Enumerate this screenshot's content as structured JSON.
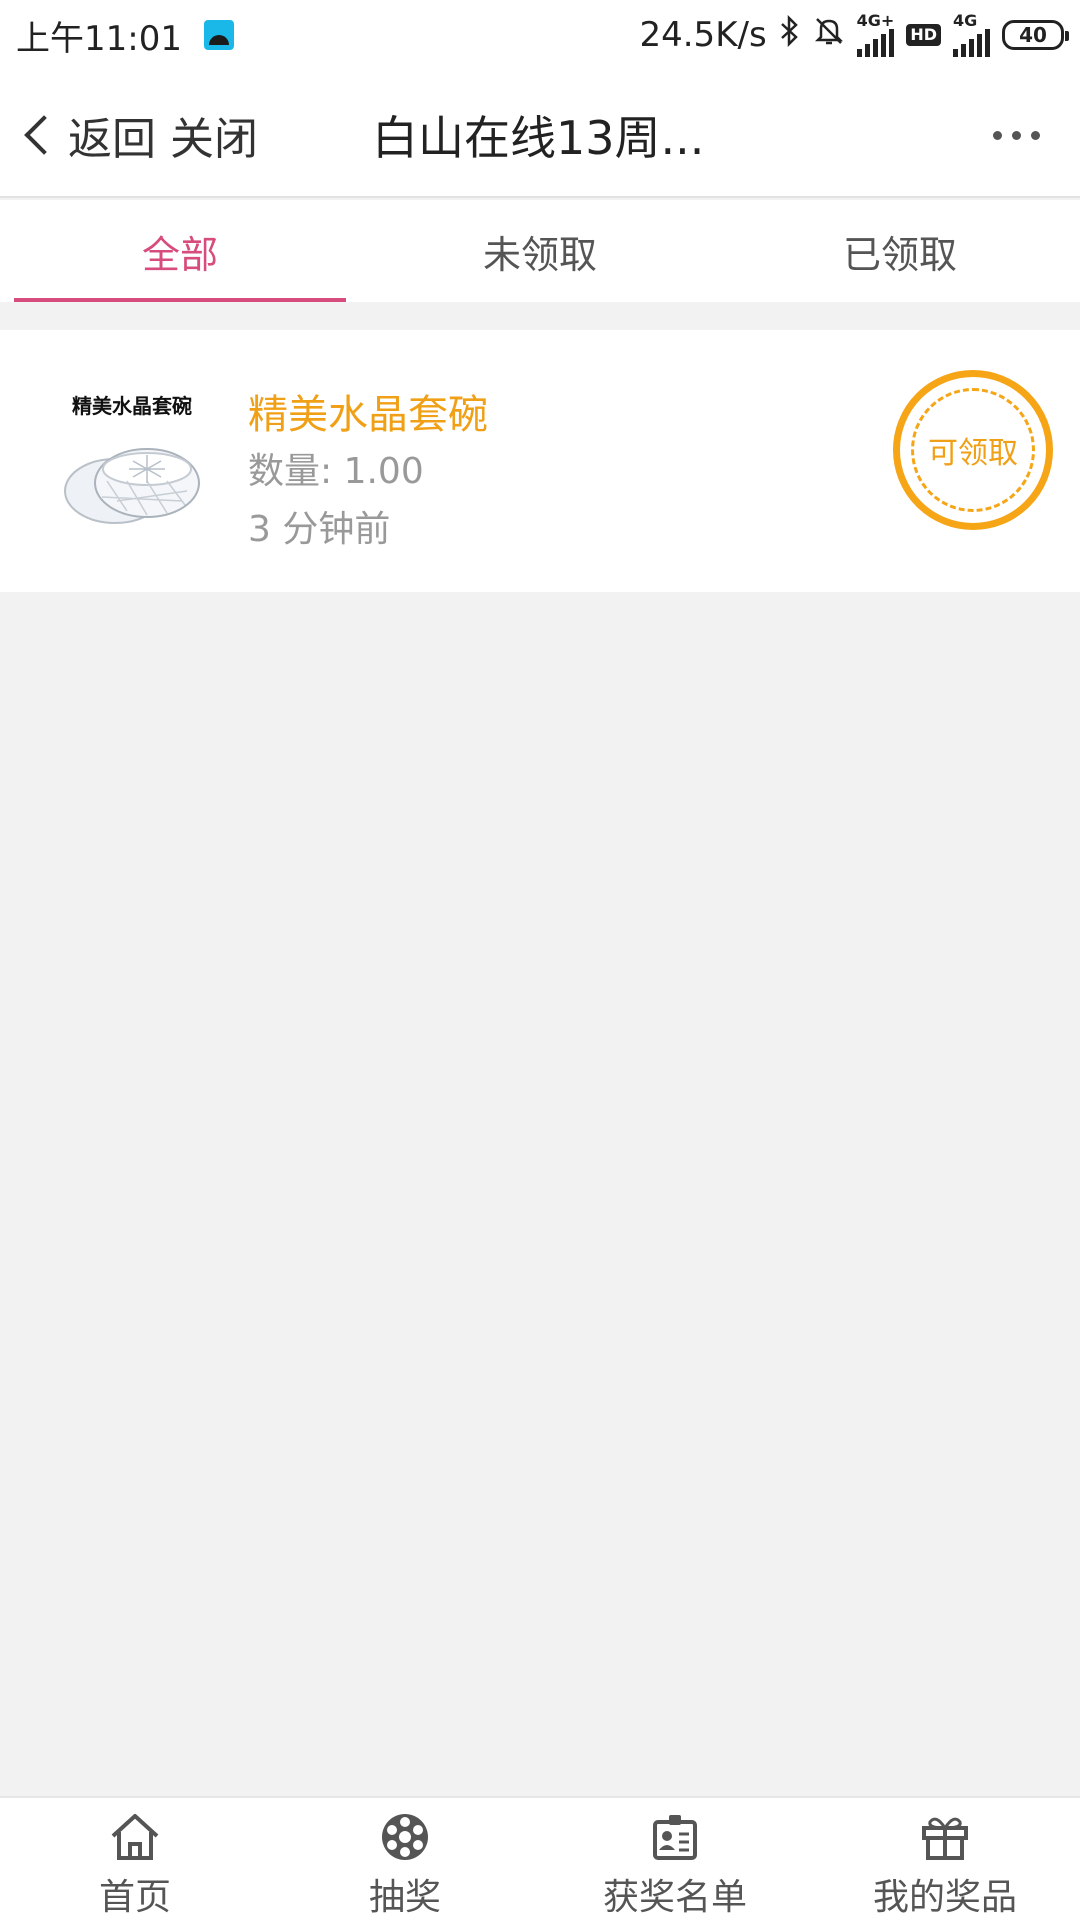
{
  "status_bar": {
    "time": "上午11:01",
    "net_speed": "24.5K/s",
    "signal1_tag": "4G+",
    "hd_badge": "HD",
    "signal2_tag": "4G",
    "battery": "40",
    "icons": [
      "app-notification-icon",
      "bluetooth-icon",
      "mute-bell-icon",
      "signal-icon",
      "signal-icon"
    ]
  },
  "nav": {
    "back_label": "返回",
    "close_label": "关闭",
    "title": "白山在线13周..."
  },
  "tabs": [
    {
      "label": "全部",
      "active": true
    },
    {
      "label": "未领取",
      "active": false
    },
    {
      "label": "已领取",
      "active": false
    }
  ],
  "prize": {
    "thumb_caption": "精美水晶套碗",
    "name": "精美水晶套碗",
    "quantity": "数量: 1.00",
    "time": "3 分钟前",
    "claim_label": "可领取"
  },
  "bottom_nav": [
    {
      "label": "首页",
      "icon": "home-icon"
    },
    {
      "label": "抽奖",
      "icon": "lottery-wheel-icon"
    },
    {
      "label": "获奖名单",
      "icon": "winner-list-icon"
    },
    {
      "label": "我的奖品",
      "icon": "gift-icon"
    }
  ],
  "colors": {
    "accent": "#d64c7c",
    "prize": "#f0a017",
    "background": "#f2f2f2"
  }
}
